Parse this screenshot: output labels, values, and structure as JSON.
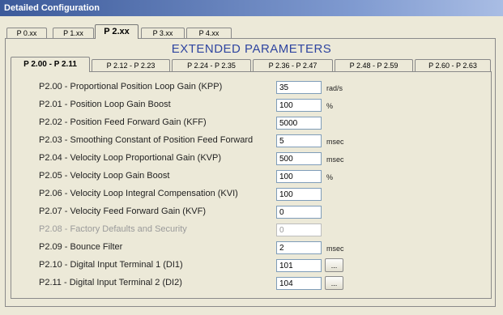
{
  "window": {
    "title": "Detailed Configuration"
  },
  "top_tabs": [
    {
      "label": "P 0.xx",
      "active": false
    },
    {
      "label": "P 1.xx",
      "active": false
    },
    {
      "label": "P 2.xx",
      "active": true
    },
    {
      "label": "P 3.xx",
      "active": false
    },
    {
      "label": "P 4.xx",
      "active": false
    }
  ],
  "section_title": "EXTENDED PARAMETERS",
  "sub_tabs": [
    {
      "label": "P 2.00 - P 2.11",
      "active": true
    },
    {
      "label": "P 2.12 - P 2.23",
      "active": false
    },
    {
      "label": "P 2.24 - P 2.35",
      "active": false
    },
    {
      "label": "P 2.36 - P 2.47",
      "active": false
    },
    {
      "label": "P 2.48 - P 2.59",
      "active": false
    },
    {
      "label": "P 2.60 - P 2.63",
      "active": false
    }
  ],
  "params": [
    {
      "label": "P2.00 - Proportional Position Loop Gain (KPP)",
      "value": "35",
      "unit": "rad/s"
    },
    {
      "label": "P2.01 - Position Loop Gain Boost",
      "value": "100",
      "unit": "%"
    },
    {
      "label": "P2.02 - Position Feed Forward Gain (KFF)",
      "value": "5000",
      "unit": ""
    },
    {
      "label": "P2.03 - Smoothing Constant of Position Feed Forward",
      "value": "5",
      "unit": "msec"
    },
    {
      "label": "P2.04 - Velocity Loop Proportional Gain (KVP)",
      "value": "500",
      "unit": "msec"
    },
    {
      "label": "P2.05 - Velocity Loop Gain Boost",
      "value": "100",
      "unit": "%"
    },
    {
      "label": "P2.06 - Velocity Loop Integral Compensation (KVI)",
      "value": "100",
      "unit": ""
    },
    {
      "label": "P2.07 - Velocity Feed Forward Gain (KVF)",
      "value": "0",
      "unit": ""
    },
    {
      "label": "P2.08 - Factory Defaults and Security",
      "value": "0",
      "unit": "",
      "disabled": true
    },
    {
      "label": "P2.09 - Bounce Filter",
      "value": "2",
      "unit": "msec"
    },
    {
      "label": "P2.10 - Digital Input Terminal 1 (DI1)",
      "value": "101",
      "unit": "",
      "button": "..."
    },
    {
      "label": "P2.11 - Digital Input Terminal 2 (DI2)",
      "value": "104",
      "unit": "",
      "button": "..."
    }
  ]
}
